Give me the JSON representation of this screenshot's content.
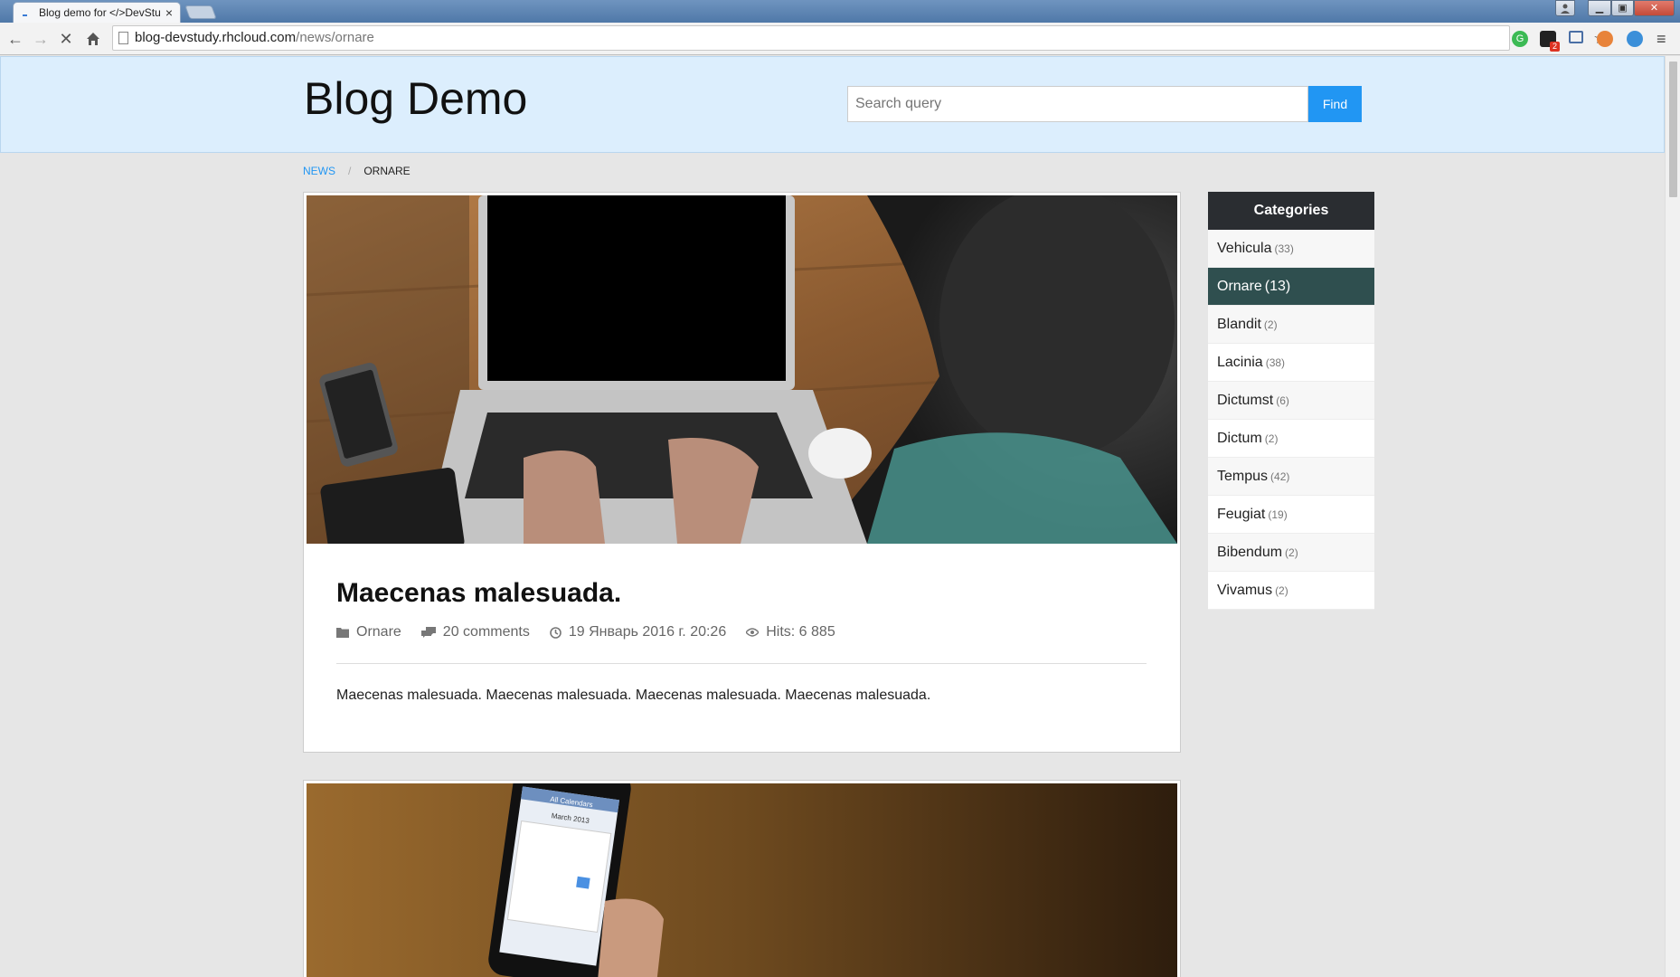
{
  "browser": {
    "tab_title": "Blog demo for </>DevStu",
    "tab_close": "×",
    "url_host": "blog-devstudy.rhcloud.com",
    "url_path": "/news/ornare",
    "extension_badge": "2"
  },
  "header": {
    "logo": "Blog Demo",
    "search_placeholder": "Search query",
    "find_label": "Find"
  },
  "breadcrumb": {
    "items": [
      "News",
      "Ornare"
    ],
    "separator": "/"
  },
  "posts": [
    {
      "title": "Maecenas malesuada.",
      "category": "Ornare",
      "comments": "20 comments",
      "date": "19 Январь 2016 г. 20:26",
      "hits": "Hits: 6 885",
      "excerpt": "Maecenas malesuada. Maecenas malesuada. Maecenas malesuada. Maecenas malesuada.",
      "image_icon": "laptop-photo-icon"
    },
    {
      "image_icon": "smartphone-calendar-photo-icon",
      "phone_screen_title": "All Calendars",
      "phone_month": "March 2013"
    }
  ],
  "categories": {
    "title": "Categories",
    "items": [
      {
        "name": "Vehicula",
        "count": "(33)"
      },
      {
        "name": "Ornare",
        "count": "(13)",
        "active": true
      },
      {
        "name": "Blandit",
        "count": "(2)"
      },
      {
        "name": "Lacinia",
        "count": "(38)"
      },
      {
        "name": "Dictumst",
        "count": "(6)"
      },
      {
        "name": "Dictum",
        "count": "(2)"
      },
      {
        "name": "Tempus",
        "count": "(42)"
      },
      {
        "name": "Feugiat",
        "count": "(19)"
      },
      {
        "name": "Bibendum",
        "count": "(2)"
      },
      {
        "name": "Vivamus",
        "count": "(2)"
      }
    ]
  },
  "colors": {
    "accent": "#2196f3",
    "header_bg": "#dceefd",
    "active_category": "#2f4f4f",
    "categories_header": "#2a2d31"
  }
}
